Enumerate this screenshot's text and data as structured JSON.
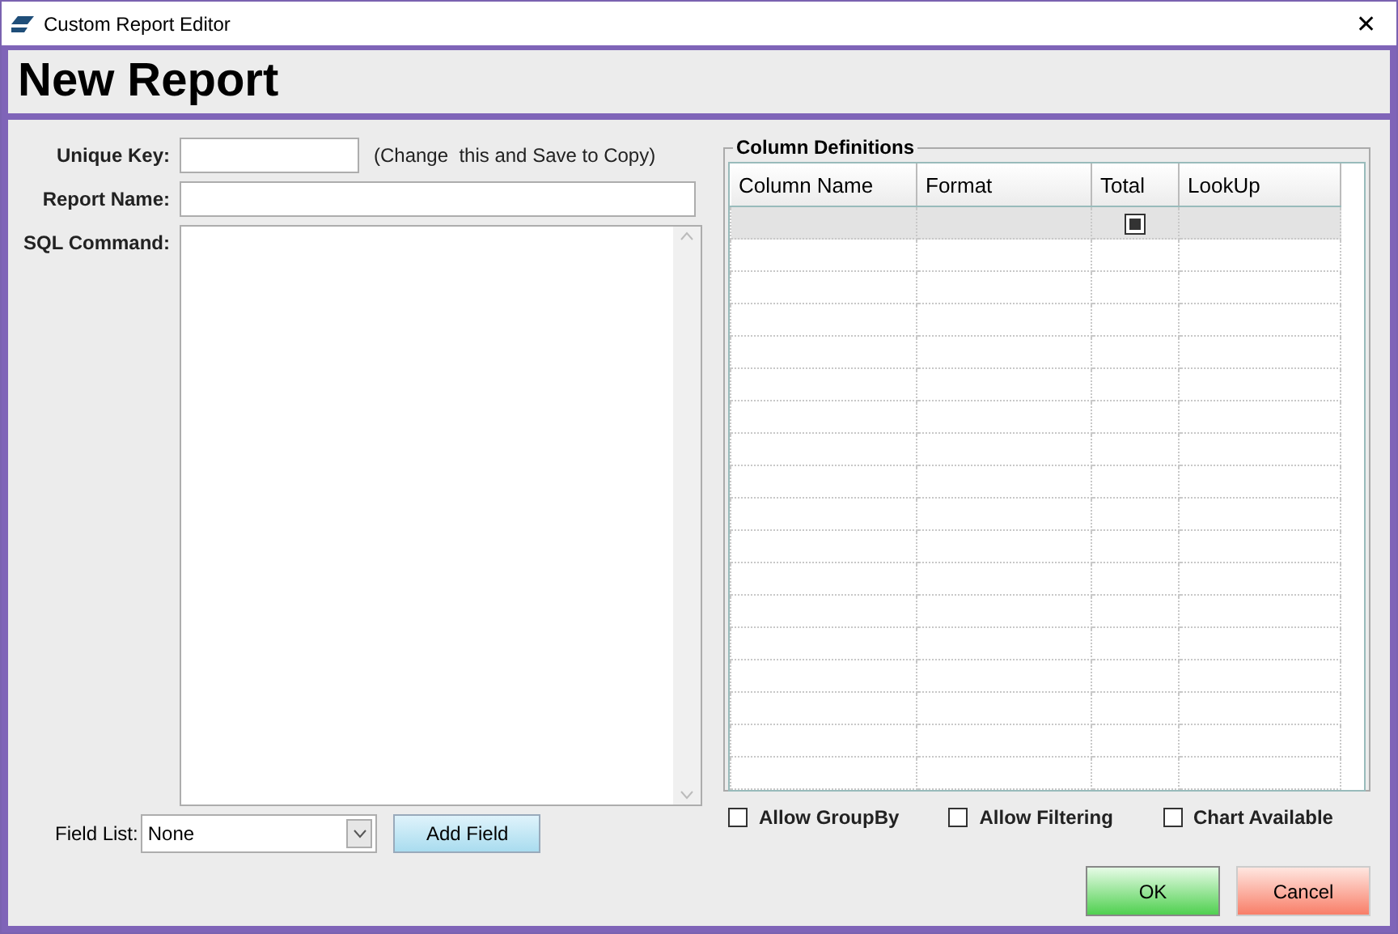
{
  "window": {
    "title": "Custom Report Editor",
    "close": "✕"
  },
  "header": {
    "title": "New Report"
  },
  "form": {
    "unique_key": {
      "label": "Unique Key:",
      "hint": "(Change  this and Save to Copy)"
    },
    "report_name": {
      "label": "Report Name:"
    },
    "sql_command": {
      "label": "SQL Command:"
    },
    "field_list": {
      "label": "Field List:",
      "value": "None"
    },
    "add_field_button": "Add Field"
  },
  "column_definitions": {
    "title": "Column Definitions",
    "columns": [
      "Column Name",
      "Format",
      "Total",
      "LookUp"
    ],
    "rows": [
      {
        "selected": true,
        "total_checked": true
      },
      {
        "selected": false
      },
      {
        "selected": false
      },
      {
        "selected": false
      },
      {
        "selected": false
      },
      {
        "selected": false
      },
      {
        "selected": false
      },
      {
        "selected": false
      },
      {
        "selected": false
      },
      {
        "selected": false
      },
      {
        "selected": false
      },
      {
        "selected": false
      },
      {
        "selected": false
      },
      {
        "selected": false
      },
      {
        "selected": false
      },
      {
        "selected": false
      },
      {
        "selected": false
      },
      {
        "selected": false
      }
    ]
  },
  "options": [
    {
      "label": "Allow GroupBy",
      "checked": false
    },
    {
      "label": "Allow Filtering",
      "checked": false
    },
    {
      "label": "Chart Available",
      "checked": false
    }
  ],
  "buttons": [
    {
      "label": "OK",
      "kind": "ok"
    },
    {
      "label": "Cancel",
      "kind": "cancel"
    }
  ]
}
